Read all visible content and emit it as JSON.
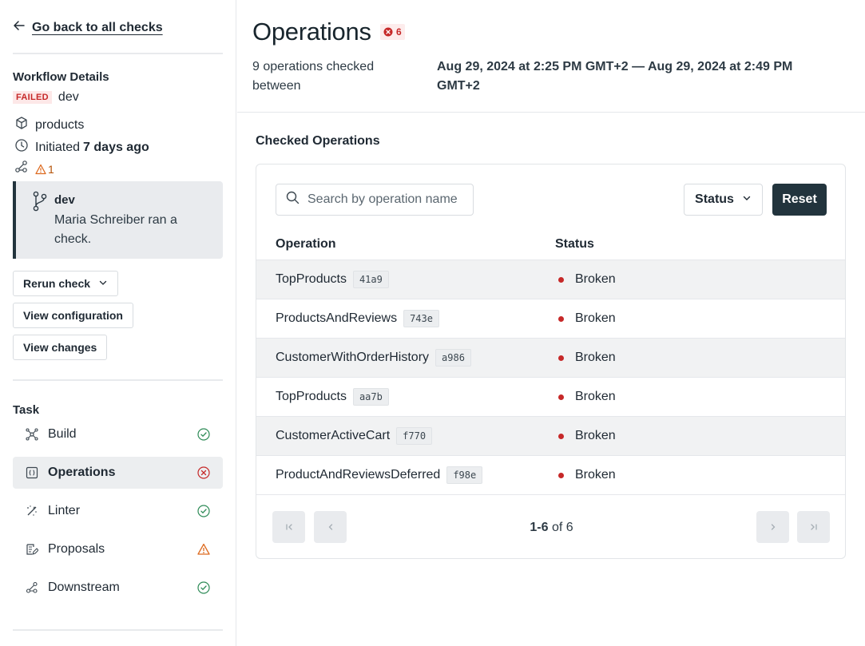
{
  "sidebar": {
    "back_label": "Go back to all checks",
    "workflow_title": "Workflow Details",
    "status_badge": "FAILED",
    "branch": "dev",
    "subgraph": "products",
    "initiated_prefix": "Initiated",
    "initiated_time": "7 days ago",
    "warning_count": "1",
    "commit": {
      "branch": "dev",
      "message": "Maria Schreiber ran a check."
    },
    "buttons": {
      "rerun": "Rerun check",
      "view_config": "View configuration",
      "view_changes": "View changes"
    },
    "task_title": "Task",
    "tasks": [
      {
        "label": "Build",
        "status": "passed"
      },
      {
        "label": "Operations",
        "status": "failed"
      },
      {
        "label": "Linter",
        "status": "passed"
      },
      {
        "label": "Proposals",
        "status": "warning"
      },
      {
        "label": "Downstream",
        "status": "passed"
      }
    ]
  },
  "header": {
    "title": "Operations",
    "error_count": "6",
    "summary_left": "9 operations checked between",
    "summary_range": "Aug 29, 2024 at 2:25 PM GMT+2 — Aug 29, 2024 at 2:49 PM GMT+2"
  },
  "checked": {
    "section_title": "Checked Operations",
    "search_placeholder": "Search by operation name",
    "status_filter_label": "Status",
    "reset_label": "Reset",
    "columns": [
      "Operation",
      "Status"
    ],
    "rows": [
      {
        "name": "TopProducts",
        "hash": "41a9",
        "status": "Broken"
      },
      {
        "name": "ProductsAndReviews",
        "hash": "743e",
        "status": "Broken"
      },
      {
        "name": "CustomerWithOrderHistory",
        "hash": "a986",
        "status": "Broken"
      },
      {
        "name": "TopProducts",
        "hash": "aa7b",
        "status": "Broken"
      },
      {
        "name": "CustomerActiveCart",
        "hash": "f770",
        "status": "Broken"
      },
      {
        "name": "ProductAndReviewsDeferred",
        "hash": "f98e",
        "status": "Broken"
      }
    ],
    "pagination": {
      "range": "1-6",
      "of_label": "of",
      "total": "6"
    }
  },
  "colors": {
    "primary": "#22343d",
    "danger": "#c62828",
    "success": "#2e8b57",
    "warning": "#dd6b20"
  }
}
